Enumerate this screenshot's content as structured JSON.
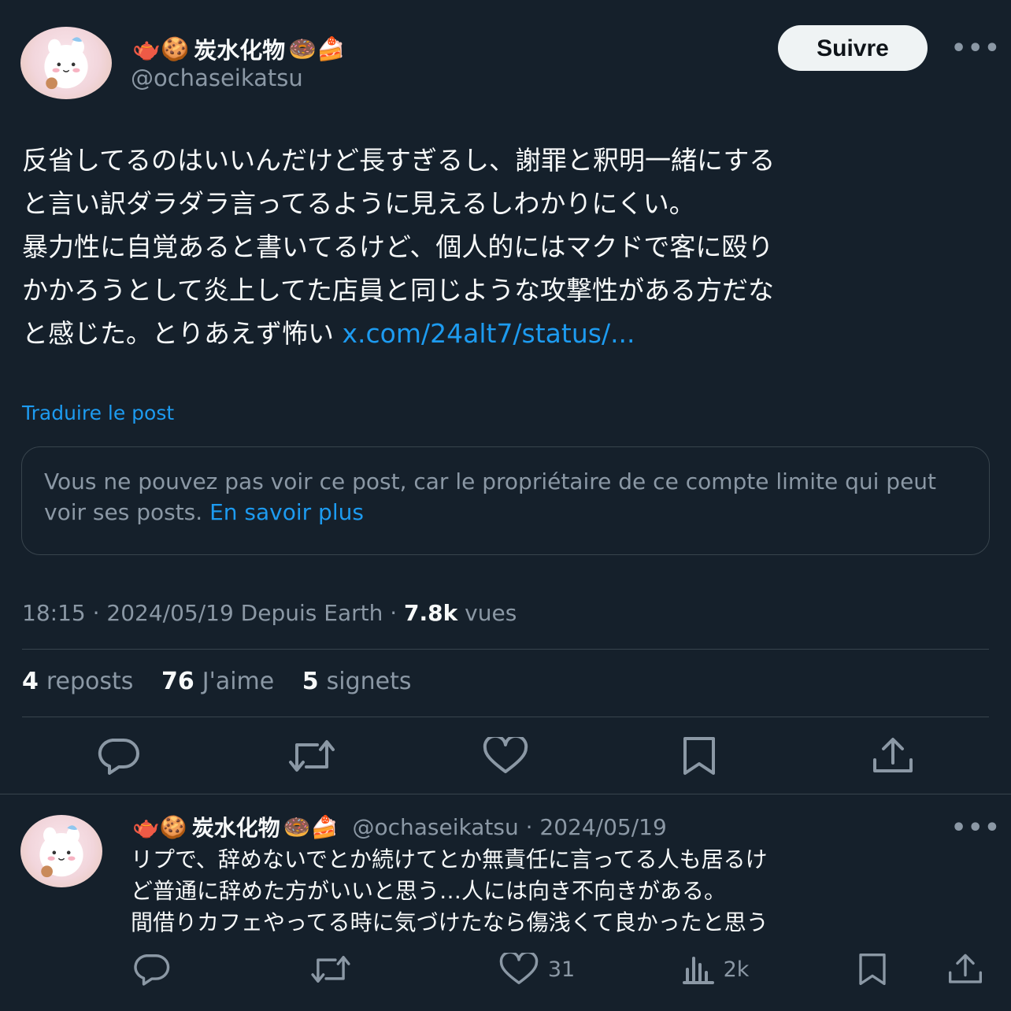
{
  "main_post": {
    "author": {
      "emoji_prefix": "🫖🍪",
      "name": "炭水化物",
      "emoji_suffix": "🍩🍰",
      "handle": "@ochaseikatsu"
    },
    "follow_label": "Suivre",
    "more_label": "•••",
    "text": "反省してるのはいいんだけど長すぎるし、謝罪と釈明一緒にする\nと言い訳ダラダラ言ってるように見えるしわかりにくい。\n暴力性に自覚あると書いてるけど、個人的にはマクドで客に殴り\nかかろうとして炎上してた店員と同じような攻撃性がある方だな\nと感じた。とりあえず怖い ",
    "link": "x.com/24alt7/status/...",
    "translate_label": "Traduire le post",
    "quoted_notice": {
      "text": "Vous ne pouvez pas voir ce post, car le propriétaire de ce compte limite qui peut voir ses posts. ",
      "learn_more": "En savoir plus"
    },
    "meta": {
      "time_date_source": "18:15 · 2024/05/19 Depuis Earth · ",
      "views_count": "7.8k",
      "views_label": " vues"
    },
    "stats": {
      "reposts_count": "4",
      "reposts_label": "reposts",
      "likes_count": "76",
      "likes_label": "J'aime",
      "bookmarks_count": "5",
      "bookmarks_label": "signets"
    }
  },
  "reply_post": {
    "author": {
      "emoji_prefix": "🫖🍪",
      "name": "炭水化物",
      "emoji_suffix": "🍩🍰",
      "handle_date": "@ochaseikatsu · 2024/05/19"
    },
    "more_label": "•••",
    "text": "リプで、辞めないでとか続けてとか無責任に言ってる人も居るけ\nど普通に辞めた方がいいと思う…人には向き不向きがある。\n間借りカフェやってる時に気づけたなら傷浅くて良かったと思う",
    "likes_count": "31",
    "views_count": "2k"
  },
  "colors": {
    "background": "#15202b",
    "accent": "#1d9bf0",
    "muted": "#8b98a5",
    "border": "#38444d"
  }
}
